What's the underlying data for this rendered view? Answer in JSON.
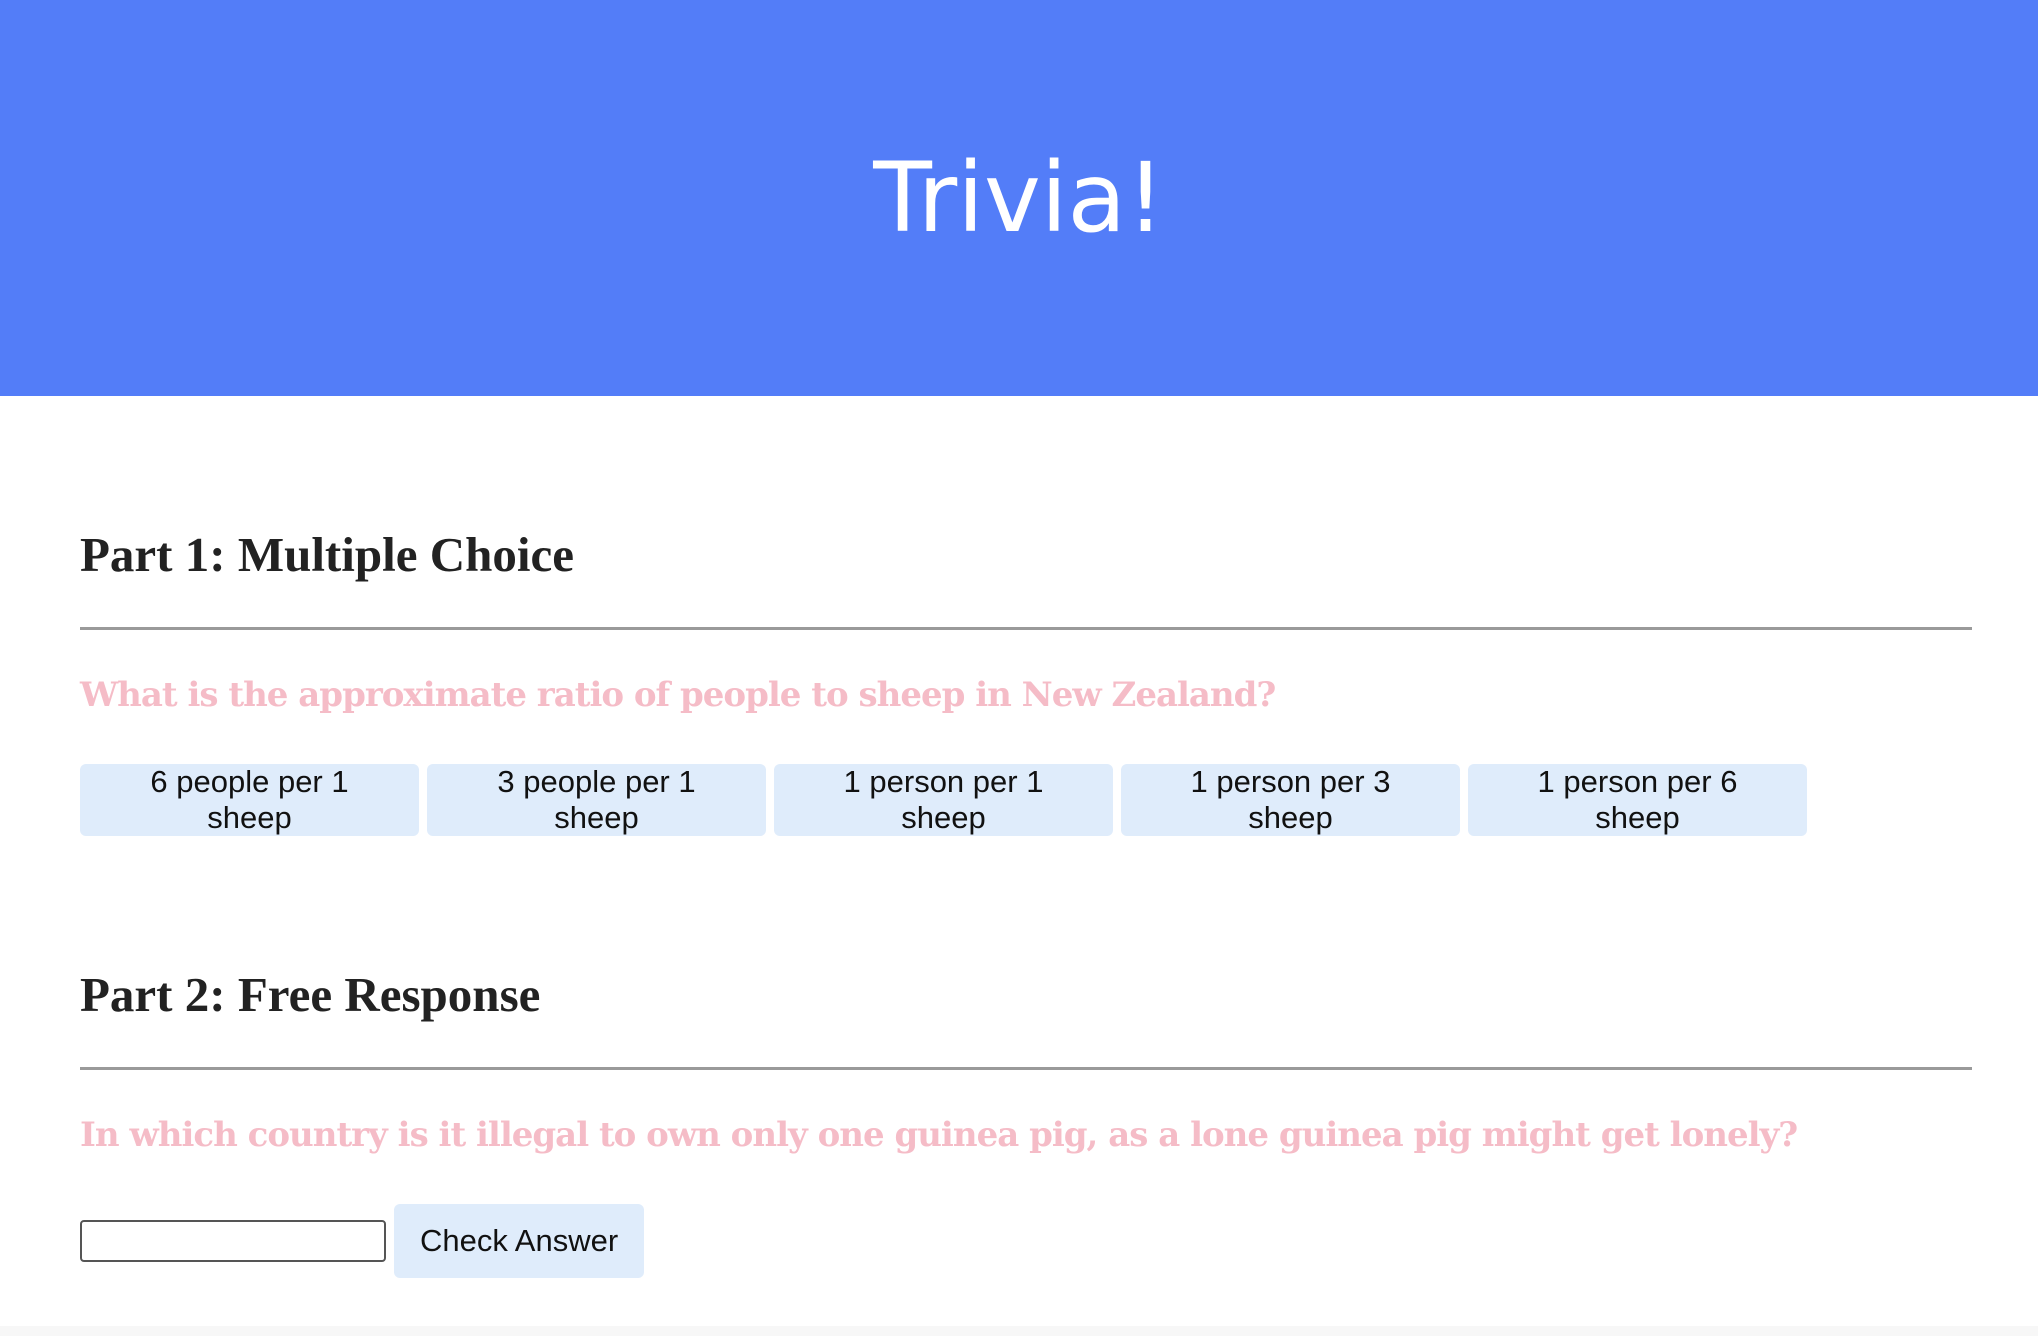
{
  "header": {
    "title": "Trivia!",
    "background_color": "#537df8"
  },
  "part1": {
    "title": "Part 1: Multiple Choice",
    "question": "What is the approximate ratio of people to sheep in New Zealand?",
    "choices": [
      "6 people per 1 sheep",
      "3 people per 1 sheep",
      "1 person per 1 sheep",
      "1 person per 3 sheep",
      "1 person per 6 sheep"
    ]
  },
  "part2": {
    "title": "Part 2: Free Response",
    "question": "In which country is it illegal to own only one guinea pig, as a lone guinea pig might get lonely?",
    "input_value": "",
    "check_label": "Check Answer"
  },
  "colors": {
    "question_text": "#f5bcc7",
    "button_background": "#dfecfb"
  }
}
